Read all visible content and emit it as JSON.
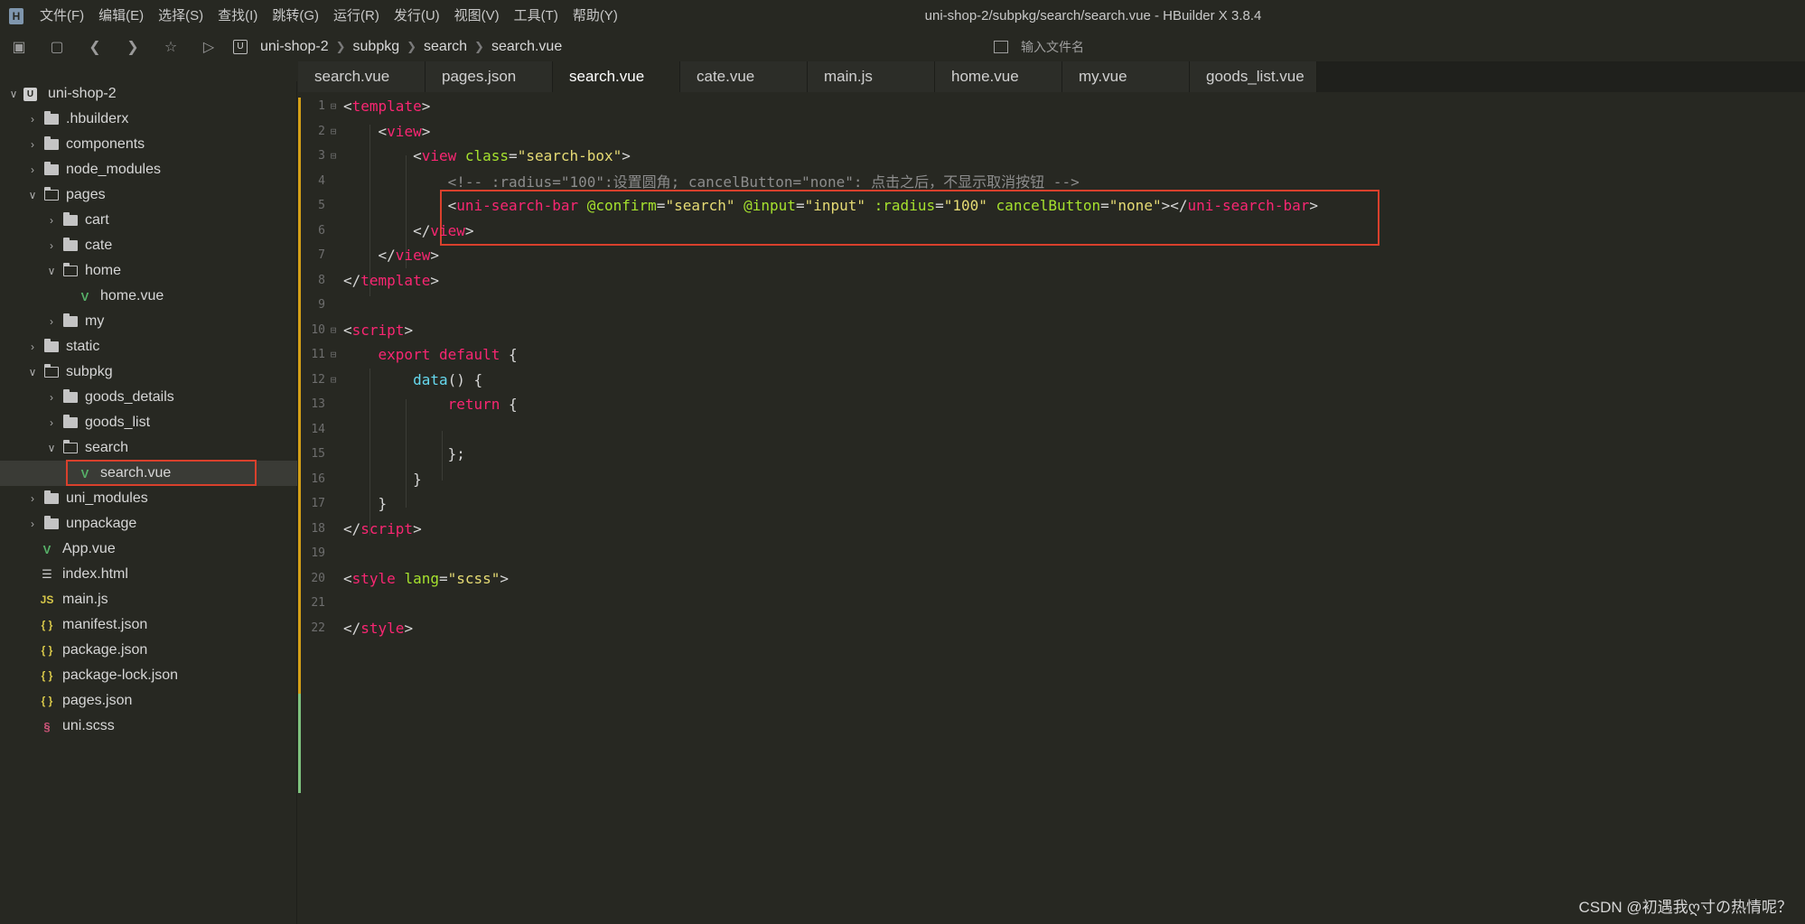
{
  "window": {
    "title": "uni-shop-2/subpkg/search/search.vue - HBuilder X 3.8.4"
  },
  "menu": [
    "文件(F)",
    "编辑(E)",
    "选择(S)",
    "查找(I)",
    "跳转(G)",
    "运行(R)",
    "发行(U)",
    "视图(V)",
    "工具(T)",
    "帮助(Y)"
  ],
  "toolbar": {
    "breadcrumb": [
      "uni-shop-2",
      "subpkg",
      "search",
      "search.vue"
    ],
    "file_search_placeholder": "输入文件名"
  },
  "tree": [
    {
      "label": "uni-shop-2",
      "kind": "project",
      "depth": 0,
      "expanded": true
    },
    {
      "label": ".hbuilderx",
      "kind": "folder",
      "depth": 1,
      "expanded": false
    },
    {
      "label": "components",
      "kind": "folder",
      "depth": 1,
      "expanded": false
    },
    {
      "label": "node_modules",
      "kind": "folder",
      "depth": 1,
      "expanded": false
    },
    {
      "label": "pages",
      "kind": "folder",
      "depth": 1,
      "expanded": true
    },
    {
      "label": "cart",
      "kind": "folder",
      "depth": 2,
      "expanded": false
    },
    {
      "label": "cate",
      "kind": "folder",
      "depth": 2,
      "expanded": false
    },
    {
      "label": "home",
      "kind": "folder",
      "depth": 2,
      "expanded": true
    },
    {
      "label": "home.vue",
      "kind": "vue",
      "depth": 3
    },
    {
      "label": "my",
      "kind": "folder",
      "depth": 2,
      "expanded": false
    },
    {
      "label": "static",
      "kind": "folder",
      "depth": 1,
      "expanded": false
    },
    {
      "label": "subpkg",
      "kind": "folder",
      "depth": 1,
      "expanded": true
    },
    {
      "label": "goods_details",
      "kind": "folder",
      "depth": 2,
      "expanded": false
    },
    {
      "label": "goods_list",
      "kind": "folder",
      "depth": 2,
      "expanded": false
    },
    {
      "label": "search",
      "kind": "folder",
      "depth": 2,
      "expanded": true
    },
    {
      "label": "search.vue",
      "kind": "vue",
      "depth": 3,
      "selected": true
    },
    {
      "label": "uni_modules",
      "kind": "folder",
      "depth": 1,
      "expanded": false
    },
    {
      "label": "unpackage",
      "kind": "folder",
      "depth": 1,
      "expanded": false
    },
    {
      "label": "App.vue",
      "kind": "vue",
      "depth": 1
    },
    {
      "label": "index.html",
      "kind": "html",
      "depth": 1
    },
    {
      "label": "main.js",
      "kind": "js",
      "depth": 1
    },
    {
      "label": "manifest.json",
      "kind": "json",
      "depth": 1
    },
    {
      "label": "package.json",
      "kind": "json",
      "depth": 1
    },
    {
      "label": "package-lock.json",
      "kind": "json",
      "depth": 1
    },
    {
      "label": "pages.json",
      "kind": "json",
      "depth": 1
    },
    {
      "label": "uni.scss",
      "kind": "scss",
      "depth": 1
    }
  ],
  "tabs": [
    {
      "label": "search.vue",
      "active": false
    },
    {
      "label": "pages.json",
      "active": false
    },
    {
      "label": "search.vue",
      "active": true
    },
    {
      "label": "cate.vue",
      "active": false
    },
    {
      "label": "main.js",
      "active": false
    },
    {
      "label": "home.vue",
      "active": false
    },
    {
      "label": "my.vue",
      "active": false
    },
    {
      "label": "goods_list.vue",
      "active": false
    }
  ],
  "code_lines": [
    {
      "n": "1",
      "fold": true,
      "parts": [
        [
          "t-punc",
          "<"
        ],
        [
          "t-tag",
          "template"
        ],
        [
          "t-punc",
          ">"
        ]
      ]
    },
    {
      "n": "2",
      "fold": true,
      "parts": [
        [
          "t-punc",
          "    <"
        ],
        [
          "t-tag",
          "view"
        ],
        [
          "t-punc",
          ">"
        ]
      ]
    },
    {
      "n": "3",
      "fold": true,
      "parts": [
        [
          "t-punc",
          "        <"
        ],
        [
          "t-tag",
          "view"
        ],
        [
          "t-punc",
          " "
        ],
        [
          "t-attr",
          "class"
        ],
        [
          "t-punc",
          "="
        ],
        [
          "t-str",
          "\"search-box\""
        ],
        [
          "t-punc",
          ">"
        ]
      ]
    },
    {
      "n": "4",
      "fold": false,
      "parts": [
        [
          "t-cm",
          "            <!-- :radius=\"100\":设置圆角; cancelButton=\"none\": 点击之后，不显示取消按钮 -->"
        ]
      ]
    },
    {
      "n": "5",
      "fold": false,
      "parts": [
        [
          "t-punc",
          "            <"
        ],
        [
          "t-tag",
          "uni-search-bar"
        ],
        [
          "t-punc",
          " "
        ],
        [
          "t-attr",
          "@confirm"
        ],
        [
          "t-punc",
          "="
        ],
        [
          "t-str",
          "\"search\""
        ],
        [
          "t-punc",
          " "
        ],
        [
          "t-attr",
          "@input"
        ],
        [
          "t-punc",
          "="
        ],
        [
          "t-str",
          "\"input\""
        ],
        [
          "t-punc",
          " "
        ],
        [
          "t-attr",
          ":radius"
        ],
        [
          "t-punc",
          "="
        ],
        [
          "t-str",
          "\"100\""
        ],
        [
          "t-punc",
          " "
        ],
        [
          "t-attr",
          "cancelButton"
        ],
        [
          "t-punc",
          "="
        ],
        [
          "t-str",
          "\"none\""
        ],
        [
          "t-punc",
          "></"
        ],
        [
          "t-tag",
          "uni-search-bar"
        ],
        [
          "t-punc",
          ">"
        ]
      ]
    },
    {
      "n": "6",
      "fold": false,
      "parts": [
        [
          "t-punc",
          "        </"
        ],
        [
          "t-tag",
          "view"
        ],
        [
          "t-punc",
          ">"
        ]
      ]
    },
    {
      "n": "7",
      "fold": false,
      "parts": [
        [
          "t-punc",
          "    </"
        ],
        [
          "t-tag",
          "view"
        ],
        [
          "t-punc",
          ">"
        ]
      ]
    },
    {
      "n": "8",
      "fold": false,
      "parts": [
        [
          "t-punc",
          "</"
        ],
        [
          "t-tag",
          "template"
        ],
        [
          "t-punc",
          ">"
        ]
      ]
    },
    {
      "n": "9",
      "fold": false,
      "parts": []
    },
    {
      "n": "10",
      "fold": true,
      "parts": [
        [
          "t-punc",
          "<"
        ],
        [
          "t-tag",
          "script"
        ],
        [
          "t-punc",
          ">"
        ]
      ]
    },
    {
      "n": "11",
      "fold": true,
      "parts": [
        [
          "t-punc",
          "    "
        ],
        [
          "t-kw",
          "export"
        ],
        [
          "t-punc",
          " "
        ],
        [
          "t-kw",
          "default"
        ],
        [
          "t-punc",
          " {"
        ]
      ]
    },
    {
      "n": "12",
      "fold": true,
      "parts": [
        [
          "t-punc",
          "        "
        ],
        [
          "t-fn",
          "data"
        ],
        [
          "t-punc",
          "() {"
        ]
      ]
    },
    {
      "n": "13",
      "fold": false,
      "parts": [
        [
          "t-punc",
          "            "
        ],
        [
          "t-kw",
          "return"
        ],
        [
          "t-punc",
          " {"
        ]
      ]
    },
    {
      "n": "14",
      "fold": false,
      "parts": []
    },
    {
      "n": "15",
      "fold": false,
      "parts": [
        [
          "t-punc",
          "            };"
        ]
      ]
    },
    {
      "n": "16",
      "fold": false,
      "parts": [
        [
          "t-punc",
          "        }"
        ]
      ]
    },
    {
      "n": "17",
      "fold": false,
      "parts": [
        [
          "t-punc",
          "    }"
        ]
      ]
    },
    {
      "n": "18",
      "fold": false,
      "parts": [
        [
          "t-punc",
          "</"
        ],
        [
          "t-tag",
          "script"
        ],
        [
          "t-punc",
          ">"
        ]
      ]
    },
    {
      "n": "19",
      "fold": false,
      "parts": []
    },
    {
      "n": "20",
      "fold": false,
      "parts": [
        [
          "t-punc",
          "<"
        ],
        [
          "t-tag",
          "style"
        ],
        [
          "t-punc",
          " "
        ],
        [
          "t-attr",
          "lang"
        ],
        [
          "t-punc",
          "="
        ],
        [
          "t-str",
          "\"scss\""
        ],
        [
          "t-punc",
          ">"
        ]
      ]
    },
    {
      "n": "21",
      "fold": false,
      "parts": []
    },
    {
      "n": "22",
      "fold": false,
      "parts": [
        [
          "t-punc",
          "</"
        ],
        [
          "t-tag",
          "style"
        ],
        [
          "t-punc",
          ">"
        ]
      ]
    }
  ],
  "watermark": "CSDN @初遇我ღ寸の热情呢？",
  "colors": {
    "background": "#272822",
    "highlight_box": "#d9402c",
    "tag": "#f92672",
    "attr": "#a6e22e",
    "string": "#e6db74"
  }
}
